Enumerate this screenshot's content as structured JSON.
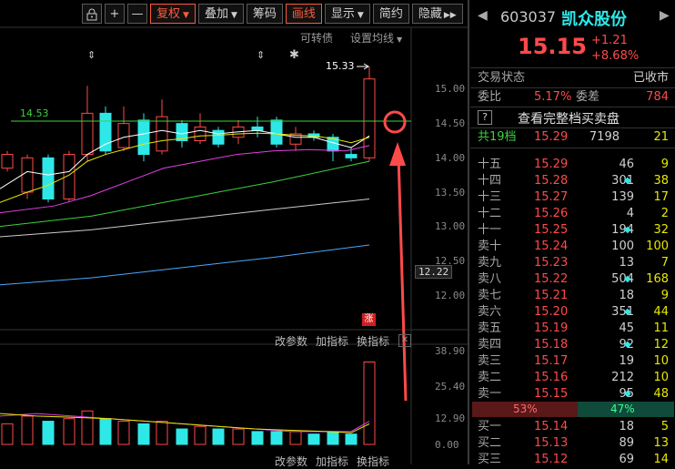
{
  "toolbar": {
    "items": [
      {
        "label": "",
        "icon": "lock-icon"
      },
      {
        "label": "+"
      },
      {
        "label": "—"
      },
      {
        "label": "复权",
        "dropdown": true,
        "active": true
      },
      {
        "label": "叠加",
        "dropdown": true
      },
      {
        "label": "筹码"
      },
      {
        "label": "画线",
        "active": true
      },
      {
        "label": "显示",
        "dropdown": true
      },
      {
        "label": "简约"
      },
      {
        "label": "隐藏",
        "icon": "double-chevron-right-icon"
      }
    ]
  },
  "chart": {
    "convertible_label": "可转债",
    "ma_setting_label": "设置均线",
    "high_label": "15.33",
    "line_label": "14.53",
    "current_price_tag": "12.22",
    "limit_up_badge": "涨",
    "y_labels": [
      "15.00",
      "14.50",
      "14.00",
      "13.50",
      "13.00",
      "12.50",
      "12.00"
    ],
    "sub_y_labels": [
      "38.90",
      "25.40",
      "12.90",
      "0.00"
    ],
    "main_actions": [
      "改参数",
      "加指标",
      "换指标"
    ],
    "sub_actions": [
      "改参数",
      "加指标",
      "换指标"
    ]
  },
  "quote": {
    "code": "603037",
    "name": "凯众股份",
    "price": "15.15",
    "change": "+1.21",
    "change_pct": "+8.68%",
    "status_label": "交易状态",
    "status_value": "已收市",
    "weibi_label": "委比",
    "weibi_value": "5.17%",
    "weicha_label": "委差",
    "weicha_value": "784",
    "full_book_label": "查看完整档买卖盘",
    "total_levels_label": "共19档",
    "total_levels_price": "15.29",
    "total_levels_vol": "7198",
    "total_levels_n": "21",
    "sell_levels": [
      {
        "label": "十五",
        "price": "15.29",
        "vol": "46",
        "dot": false,
        "n": "9"
      },
      {
        "label": "十四",
        "price": "15.28",
        "vol": "301",
        "dot": true,
        "n": "38"
      },
      {
        "label": "十三",
        "price": "15.27",
        "vol": "139",
        "dot": false,
        "n": "17"
      },
      {
        "label": "十二",
        "price": "15.26",
        "vol": "4",
        "dot": false,
        "n": "2"
      },
      {
        "label": "十一",
        "price": "15.25",
        "vol": "194",
        "dot": true,
        "n": "32"
      },
      {
        "label": "卖十",
        "price": "15.24",
        "vol": "100",
        "dot": false,
        "n": "100"
      },
      {
        "label": "卖九",
        "price": "15.23",
        "vol": "13",
        "dot": false,
        "n": "7"
      },
      {
        "label": "卖八",
        "price": "15.22",
        "vol": "504",
        "dot": true,
        "n": "168"
      },
      {
        "label": "卖七",
        "price": "15.21",
        "vol": "18",
        "dot": false,
        "n": "9"
      },
      {
        "label": "卖六",
        "price": "15.20",
        "vol": "351",
        "dot": true,
        "n": "44"
      },
      {
        "label": "卖五",
        "price": "15.19",
        "vol": "45",
        "dot": false,
        "n": "11"
      },
      {
        "label": "卖四",
        "price": "15.18",
        "vol": "92",
        "dot": true,
        "n": "12"
      },
      {
        "label": "卖三",
        "price": "15.17",
        "vol": "19",
        "dot": false,
        "n": "10"
      },
      {
        "label": "卖二",
        "price": "15.16",
        "vol": "212",
        "dot": false,
        "n": "10"
      },
      {
        "label": "卖一",
        "price": "15.15",
        "vol": "95",
        "dot": true,
        "n": "48"
      }
    ],
    "ratio_sell": "53%",
    "ratio_buy": "47%",
    "buy_levels": [
      {
        "label": "买一",
        "price": "15.14",
        "vol": "18",
        "dot": false,
        "n": "5"
      },
      {
        "label": "买二",
        "price": "15.13",
        "vol": "89",
        "dot": false,
        "n": "13"
      },
      {
        "label": "买三",
        "price": "15.12",
        "vol": "69",
        "dot": false,
        "n": "14"
      }
    ]
  },
  "colors": {
    "up": "#ff4a4a",
    "down": "#2ee8e8",
    "accent": "#ff5a3c"
  }
}
